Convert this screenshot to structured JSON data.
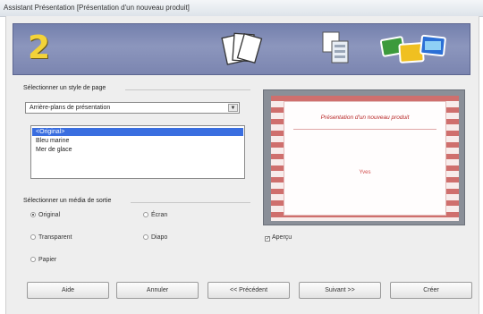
{
  "window": {
    "title": "Assistant Présentation [Présentation d'un nouveau produit]"
  },
  "banner": {
    "step_number": "2",
    "colors": {
      "background": "#7d87b2",
      "number": "#f3d338"
    },
    "icons": [
      "pages-fan-icon",
      "slide-copies-icon",
      "photo-cards-icon"
    ]
  },
  "page_style": {
    "group_label": "Sélectionner un style de page",
    "category_value": "Arrière-plans de présentation",
    "items": [
      {
        "label": "<Original>",
        "selected": true
      },
      {
        "label": "Bleu marine",
        "selected": false
      },
      {
        "label": "Mer de glace",
        "selected": false
      }
    ]
  },
  "output_medium": {
    "group_label": "Sélectionner un média de sortie",
    "options": [
      {
        "label": "Original",
        "selected": true
      },
      {
        "label": "Écran",
        "selected": false
      },
      {
        "label": "Transparent",
        "selected": false
      },
      {
        "label": "Diapo",
        "selected": false
      },
      {
        "label": "Papier",
        "selected": false
      }
    ]
  },
  "preview": {
    "slide_title": "Présentation d'un nouveau produit",
    "slide_subtitle": "Yves",
    "checkbox_label": "Aperçu",
    "checkbox_checked": true,
    "colors": {
      "stripe": "#cf6f6d",
      "title": "#b82828"
    }
  },
  "buttons": {
    "help": "Aide",
    "cancel": "Annuler",
    "previous": "<< Précédent",
    "next": "Suivant >>",
    "create": "Créer"
  }
}
